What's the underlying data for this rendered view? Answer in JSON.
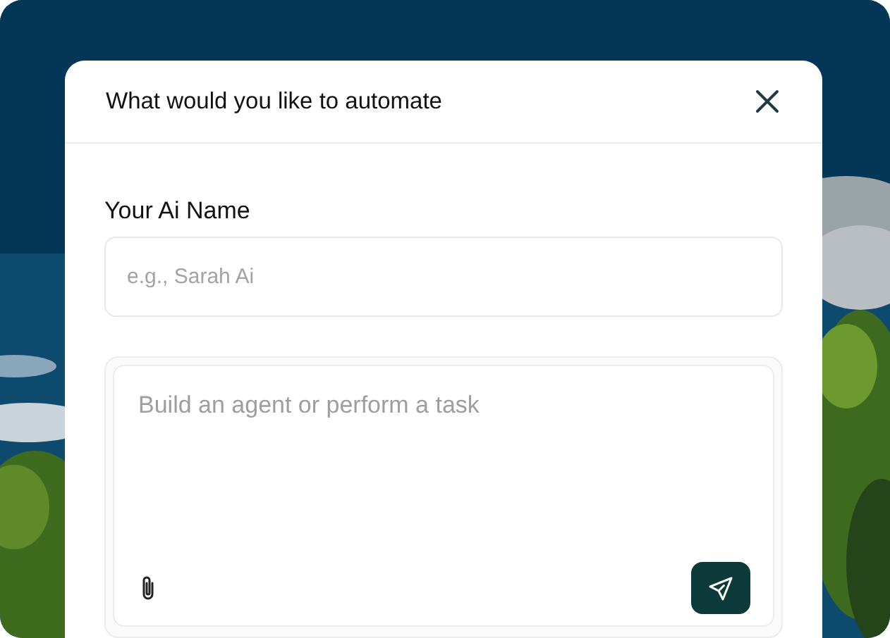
{
  "dialog": {
    "title": "What would you like to automate"
  },
  "name_field": {
    "label": "Your Ai Name",
    "placeholder": "e.g., Sarah Ai"
  },
  "prompt": {
    "placeholder": "Build an agent or perform a task"
  }
}
